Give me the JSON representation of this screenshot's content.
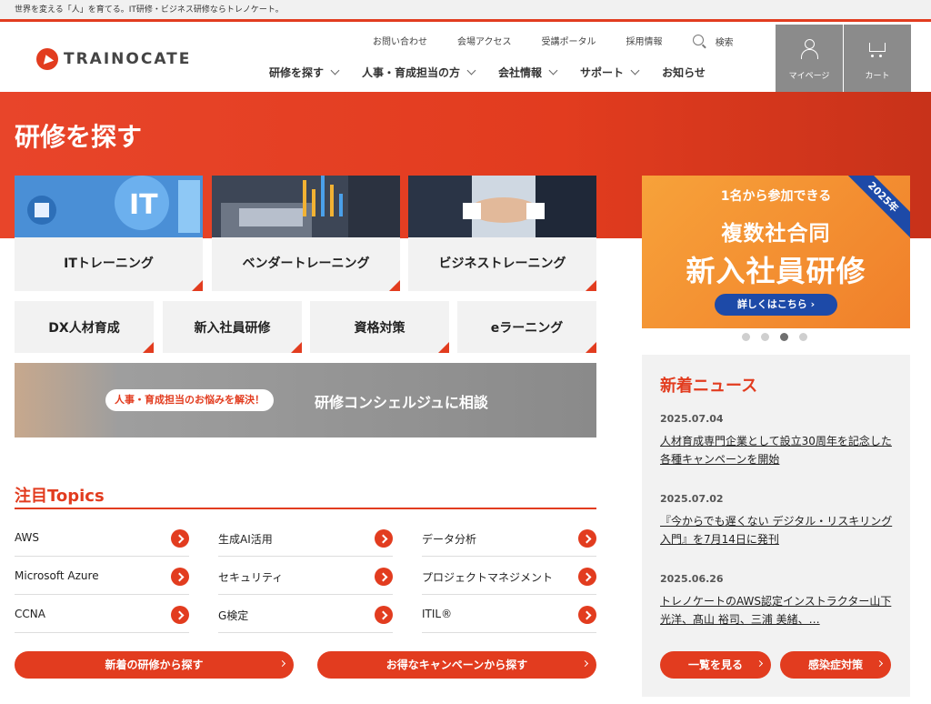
{
  "topbar": {
    "tagline": "世界を変える「人」を育てる。IT研修・ビジネス研修ならトレノケート。"
  },
  "header": {
    "logo_text": "TRAINOCATE",
    "utility_links": [
      "お問い合わせ",
      "会場アクセス",
      "受講ポータル",
      "採用情報"
    ],
    "search_label": "検索",
    "main_nav": [
      "研修を探す",
      "人事・育成担当の方",
      "会社情報",
      "サポート",
      "お知らせ"
    ],
    "mypage_label": "マイページ",
    "cart_label": "カート"
  },
  "hero": {
    "title": "研修を探す"
  },
  "categories": {
    "large": [
      "ITトレーニング",
      "ベンダートレーニング",
      "ビジネストレーニング"
    ],
    "small": [
      "DX人材育成",
      "新入社員研修",
      "資格対策",
      "eラーニング"
    ]
  },
  "banner": {
    "ribbon": "2025年",
    "line1": "1名から参加できる",
    "line2": "複数社合同",
    "line3": "新入社員研修",
    "button": "詳しくはこちら ›",
    "dots": 4,
    "active_dot": 2
  },
  "concierge": {
    "pill": "人事・育成担当のお悩みを解決！",
    "text": "研修コンシェルジュに相談"
  },
  "topics": {
    "title": "注目Topics",
    "items": [
      "AWS",
      "生成AI活用",
      "データ分析",
      "Microsoft Azure",
      "セキュリティ",
      "プロジェクトマネジメント",
      "CCNA",
      "G検定",
      "ITIL®"
    ]
  },
  "buttons": {
    "new_courses": "新着の研修から探す",
    "campaign": "お得なキャンペーンから探す"
  },
  "news": {
    "title": "新着ニュース",
    "items": [
      {
        "date": "2025.07.04",
        "text": "人材育成専門企業として設立30周年を記念した各種キャンペーンを開始"
      },
      {
        "date": "2025.07.02",
        "text": "『今からでも遅くない デジタル・リスキリング入門』を7月14日に発刊"
      },
      {
        "date": "2025.06.26",
        "text": "トレノケートのAWS認定インストラクター山下 光洋、髙山 裕司、三浦 美緒、…"
      }
    ],
    "see_all": "一覧を見る",
    "infection": "感染症対策"
  },
  "colors": {
    "brand": "#e23c1f",
    "header_button": "#8b8b8b",
    "panel": "#f2f2f2"
  }
}
